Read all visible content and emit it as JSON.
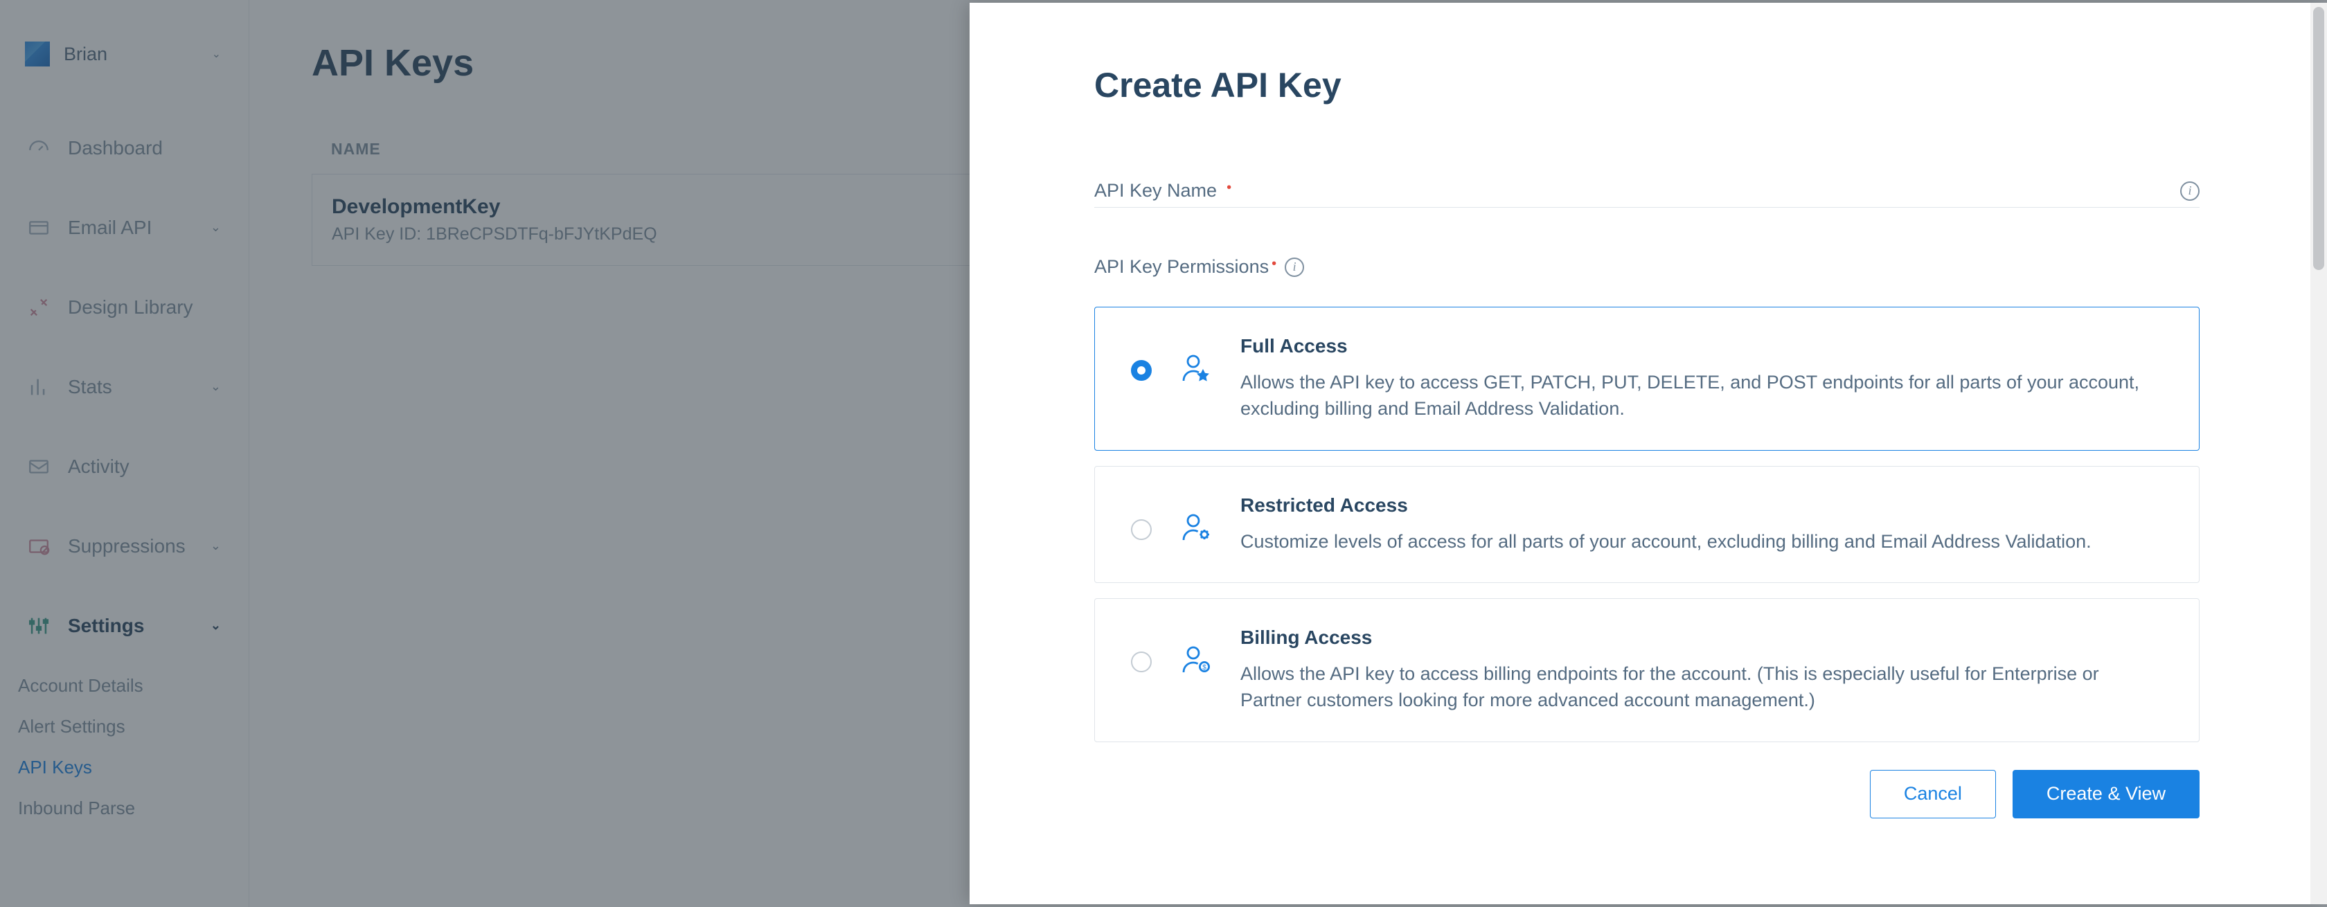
{
  "account": {
    "name": "Brian"
  },
  "sidebar": {
    "items": [
      {
        "label": "Dashboard",
        "expandable": false
      },
      {
        "label": "Email API",
        "expandable": true
      },
      {
        "label": "Design Library",
        "expandable": false
      },
      {
        "label": "Stats",
        "expandable": true
      },
      {
        "label": "Activity",
        "expandable": false
      },
      {
        "label": "Suppressions",
        "expandable": true
      },
      {
        "label": "Settings",
        "expandable": true,
        "active": true
      }
    ],
    "settings_sub": [
      {
        "label": "Account Details"
      },
      {
        "label": "Alert Settings"
      },
      {
        "label": "API Keys",
        "active": true
      },
      {
        "label": "Inbound Parse"
      }
    ]
  },
  "page": {
    "title": "API Keys",
    "column_header": "NAME",
    "key": {
      "name": "DevelopmentKey",
      "id_label": "API Key ID:",
      "id": "1BReCPSDTFq-bFJYtKPdEQ"
    }
  },
  "drawer": {
    "title": "Create API Key",
    "name_label": "API Key Name",
    "perm_label": "API Key Permissions",
    "options": [
      {
        "title": "Full Access",
        "desc": "Allows the API key to access GET, PATCH, PUT, DELETE, and POST endpoints for all parts of your account, excluding billing and Email Address Validation.",
        "selected": true
      },
      {
        "title": "Restricted Access",
        "desc": "Customize levels of access for all parts of your account, excluding billing and Email Address Validation."
      },
      {
        "title": "Billing Access",
        "desc": "Allows the API key to access billing endpoints for the account. (This is especially useful for Enterprise or Partner customers looking for more advanced account management.)"
      }
    ],
    "buttons": {
      "cancel": "Cancel",
      "submit": "Create & View"
    }
  }
}
